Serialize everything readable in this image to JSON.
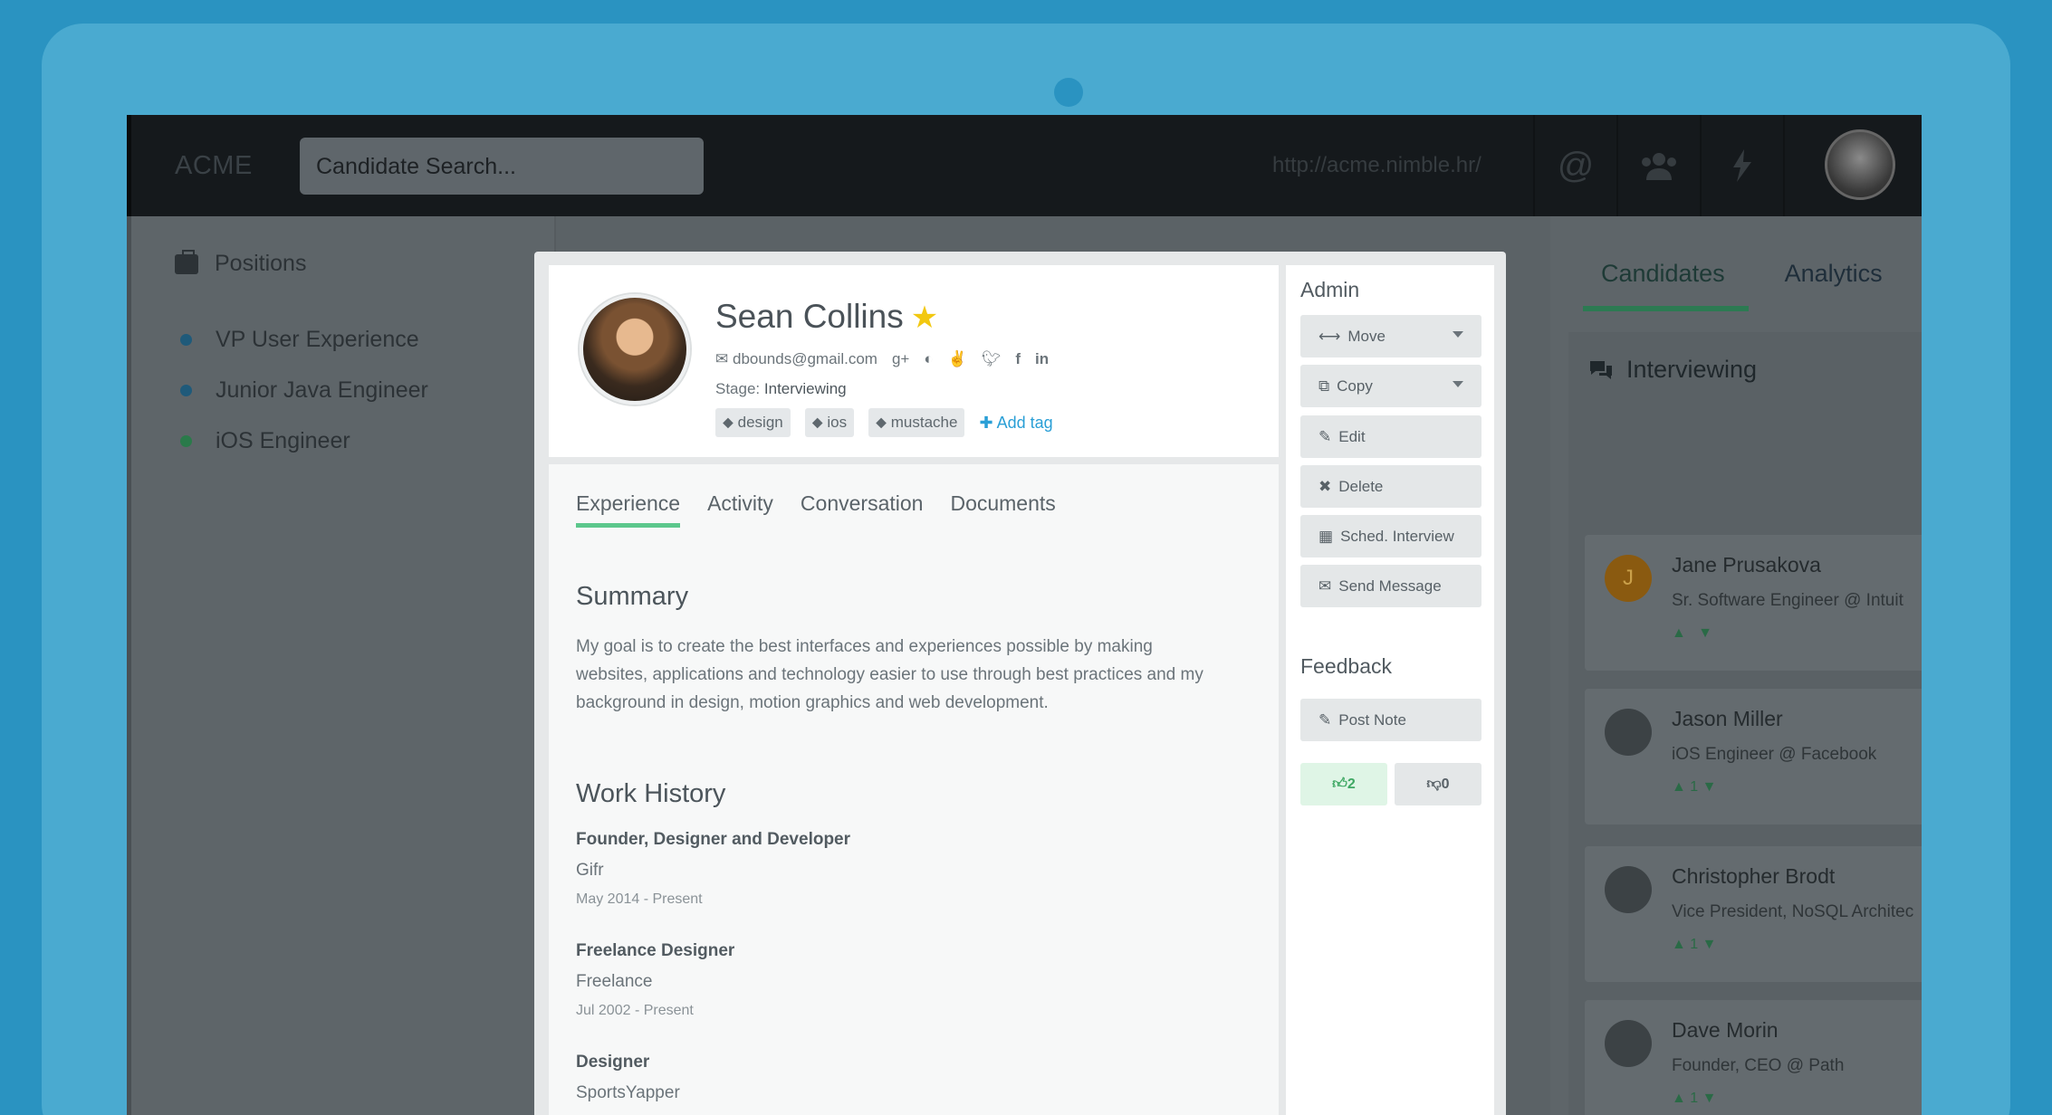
{
  "topbar": {
    "brand": "ACME",
    "search_placeholder": "Candidate Search...",
    "url": "http://acme.nimble.hr/",
    "icons": [
      "at-icon",
      "users-icon",
      "bolt-icon"
    ]
  },
  "sidebar": {
    "title": "Positions",
    "items": [
      {
        "label": "VP User Experience",
        "color": "#1f5a7a"
      },
      {
        "label": "Junior Java Engineer",
        "color": "#1f5a7a"
      },
      {
        "label": "iOS Engineer",
        "color": "#2a7a4a"
      }
    ]
  },
  "right": {
    "tabs": [
      "Candidates",
      "Analytics"
    ],
    "heading": "Interviewing",
    "cards": [
      {
        "name": "Jane Prusakova",
        "sub": "Sr. Software Engineer @ Intuit",
        "votes": "",
        "initial": "J"
      },
      {
        "name": "Jason Miller",
        "sub": "iOS Engineer @ Facebook",
        "votes": "1"
      },
      {
        "name": "Christopher Brodt",
        "sub": "Vice President, NoSQL Architec",
        "votes": "1"
      },
      {
        "name": "Dave Morin",
        "sub": "Founder, CEO @ Path",
        "votes": "1"
      }
    ]
  },
  "profile": {
    "name": "Sean Collins",
    "email": "dbounds@gmail.com",
    "stage_label": "Stage:",
    "stage_value": "Interviewing",
    "tags": [
      "design",
      "ios",
      "mustache"
    ],
    "add_tag": "Add tag"
  },
  "tabs": [
    "Experience",
    "Activity",
    "Conversation",
    "Documents"
  ],
  "summary": {
    "heading": "Summary",
    "text": "My goal is to create the best interfaces and experiences possible by making websites, applications and technology easier to use through best practices and my background in design, motion graphics and web development."
  },
  "work": {
    "heading": "Work History",
    "jobs": [
      {
        "title": "Founder, Designer and Developer",
        "company": "Gifr",
        "dates": "May 2014 - Present"
      },
      {
        "title": "Freelance Designer",
        "company": "Freelance",
        "dates": "Jul 2002 - Present"
      },
      {
        "title": "Designer",
        "company": "SportsYapper",
        "dates": ""
      }
    ]
  },
  "admin": {
    "heading": "Admin",
    "buttons": [
      "Move",
      "Copy",
      "Edit",
      "Delete",
      "Sched. Interview",
      "Send Message"
    ]
  },
  "feedback": {
    "heading": "Feedback",
    "post_note": "Post Note",
    "up_count": "2",
    "down_count": "0"
  }
}
